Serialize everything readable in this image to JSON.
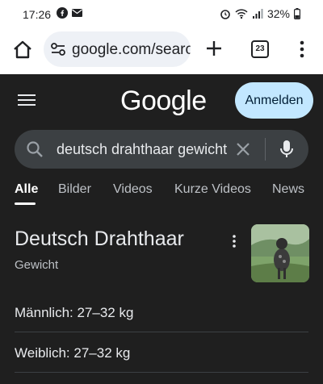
{
  "status": {
    "time": "17:26",
    "battery": "32%"
  },
  "browser": {
    "url": "google.com/searc",
    "tab_count": "23"
  },
  "google": {
    "logo": "Google",
    "signin_label": "Anmelden"
  },
  "search": {
    "query": "deutsch drahthaar gewicht"
  },
  "tabs": [
    "Alle",
    "Bilder",
    "Videos",
    "Kurze Videos",
    "News"
  ],
  "result": {
    "title": "Deutsch Drahthaar",
    "subtitle": "Gewicht",
    "facts": [
      "Männlich: 27–32 kg",
      "Weiblich: 27–32 kg"
    ]
  },
  "icons": {
    "home": "home-icon",
    "tune": "site-settings-icon",
    "plus": "new-tab-icon",
    "tabs": "tab-switcher-icon",
    "menu": "overflow-menu-icon",
    "hamburger": "hamburger-menu-icon",
    "search": "search-icon",
    "clear": "close-icon",
    "mic": "microphone-icon",
    "kebab": "more-options-icon"
  }
}
